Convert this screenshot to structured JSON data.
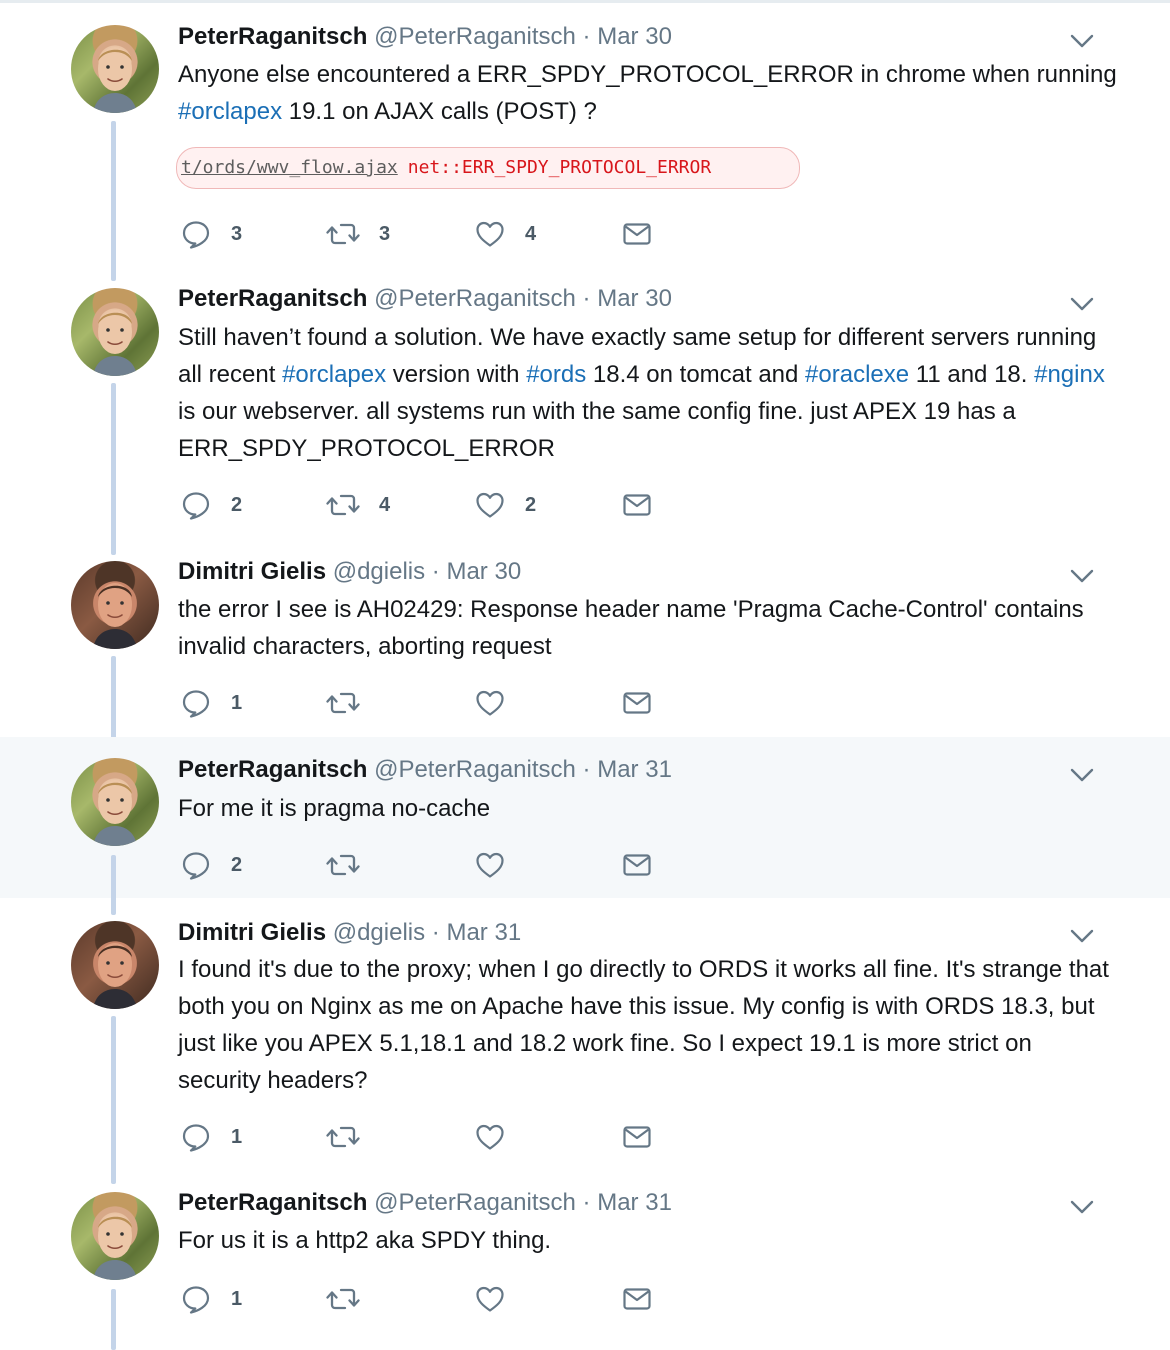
{
  "colors": {
    "hashtag": "#1b6fb6",
    "meta": "#657786",
    "thread_line": "#c4d4e9",
    "highlight_bg": "#f5f8fa",
    "error_text": "#d8161b"
  },
  "tweets": [
    {
      "name": "PeterRaganitsch",
      "handle": "@PeterRaganitsch",
      "sep": "·",
      "date": "Mar 30",
      "text": [
        "Anyone else encountered a ERR_SPDY_PROTOCOL_ERROR in chrome when running ",
        "#orclapex",
        " 19.1 on AJAX calls (POST) ?"
      ],
      "embed": {
        "url": "t/ords/wwv_flow.ajax",
        "message": "net::ERR_SPDY_PROTOCOL_ERROR"
      },
      "replies": "3",
      "retweets": "3",
      "likes": "4"
    },
    {
      "name": "PeterRaganitsch",
      "handle": "@PeterRaganitsch",
      "sep": "·",
      "date": "Mar 30",
      "text": [
        "Still haven’t found a solution. We have exactly same setup for different servers running all recent ",
        "#orclapex",
        " version with ",
        "#ords",
        " 18.4 on tomcat and ",
        "#oraclexe",
        " 11 and 18. ",
        "#nginx",
        " is our webserver. all systems run with the same config fine. just APEX 19 has a ERR_SPDY_PROTOCOL_ERROR"
      ],
      "replies": "2",
      "retweets": "4",
      "likes": "2"
    },
    {
      "name": "Dimitri Gielis",
      "handle": "@dgielis",
      "sep": "·",
      "date": "Mar 30",
      "text": [
        "the error I see is AH02429: Response header name 'Pragma Cache-Control' contains invalid characters, aborting request"
      ],
      "replies": "1",
      "retweets": "",
      "likes": ""
    },
    {
      "name": "PeterRaganitsch",
      "handle": "@PeterRaganitsch",
      "sep": "·",
      "date": "Mar 31",
      "text": [
        "For me it is pragma no-cache"
      ],
      "replies": "2",
      "retweets": "",
      "likes": ""
    },
    {
      "name": "Dimitri Gielis",
      "handle": "@dgielis",
      "sep": "·",
      "date": "Mar 31",
      "text": [
        "I found it's due to the proxy; when I go directly to ORDS it works all fine. It's strange that both you on Nginx as me on Apache have this issue. My config is with ORDS 18.3, but just like you APEX 5.1,18.1 and 18.2 work fine. So I expect 19.1 is more strict on security headers?"
      ],
      "replies": "1",
      "retweets": "",
      "likes": ""
    },
    {
      "name": "PeterRaganitsch",
      "handle": "@PeterRaganitsch",
      "sep": "·",
      "date": "Mar 31",
      "text": [
        "For us it is a http2 aka SPDY thing."
      ],
      "replies": "1",
      "retweets": "",
      "likes": ""
    }
  ]
}
